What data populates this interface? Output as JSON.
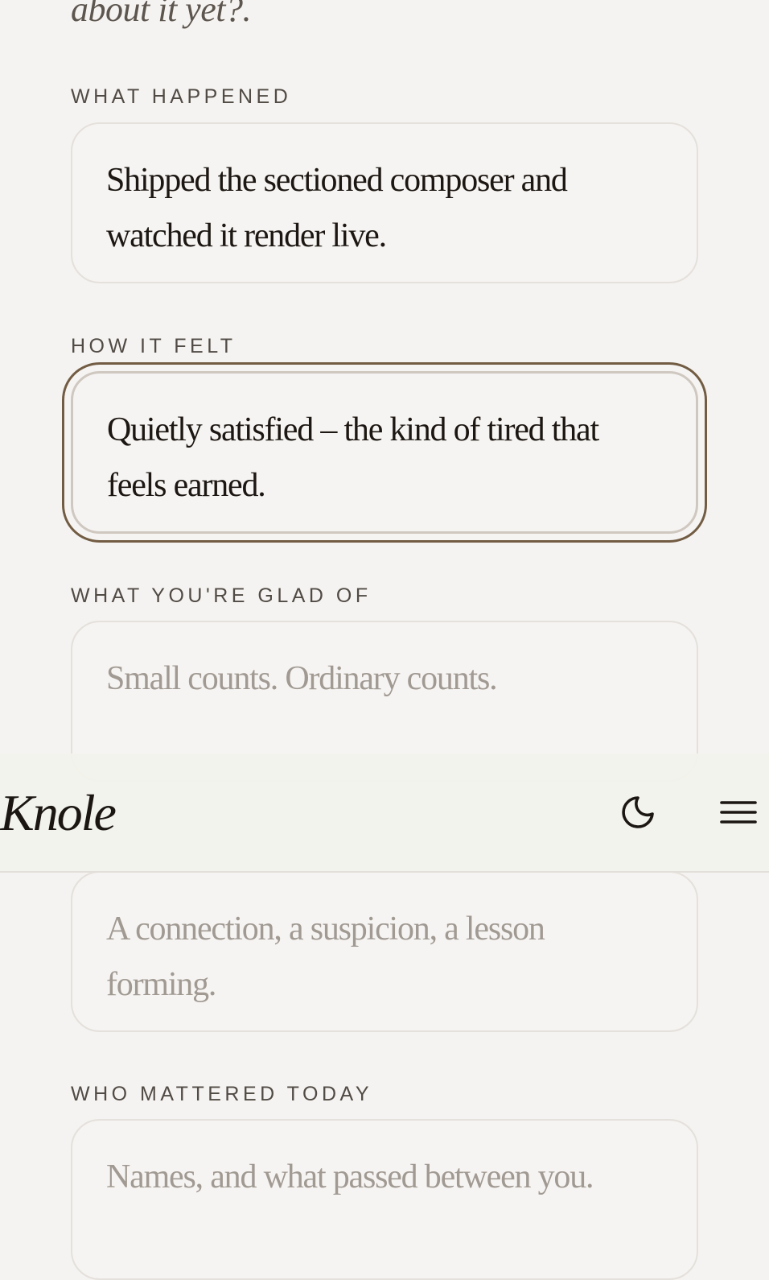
{
  "intro": {
    "tail_text": "about it yet?."
  },
  "sections": [
    {
      "label": "WHAT HAPPENED",
      "value": "Shipped the sectioned composer and watched it render live.",
      "placeholder": ""
    },
    {
      "label": "HOW IT FELT",
      "value": "Quietly satisfied – the kind of tired that feels earned.",
      "placeholder": ""
    },
    {
      "label": "WHAT YOU'RE GLAD OF",
      "value": "",
      "placeholder": "Small counts. Ordinary counts."
    },
    {
      "label": "",
      "value": "",
      "placeholder": "A connection, a suspicion, a lesson forming."
    },
    {
      "label": "WHO MATTERED TODAY",
      "value": "",
      "placeholder": "Names, and what passed between you."
    }
  ],
  "nav": {
    "brand": "Knole",
    "icons": [
      "moon-icon",
      "menu-icon"
    ]
  },
  "colors": {
    "background": "#f5f3f1",
    "focus_ring": "#725c43",
    "text": "#1c1712",
    "placeholder": "#a19a93",
    "label": "#514b45"
  }
}
